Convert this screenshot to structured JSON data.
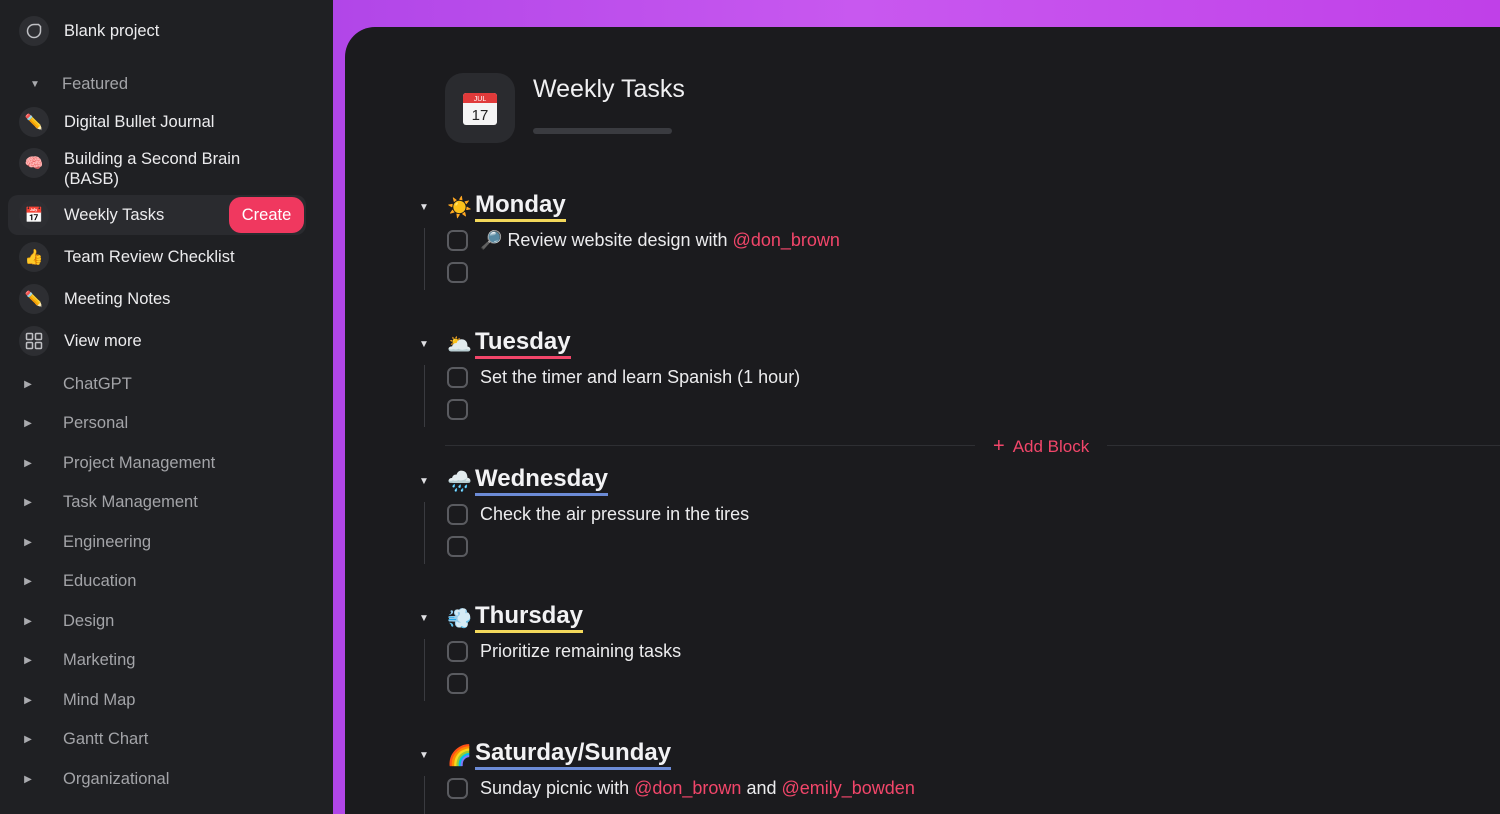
{
  "sidebar": {
    "blank_project": "Blank project",
    "featured": "Featured",
    "items": [
      {
        "label": "Digital Bullet Journal",
        "icon": "pencil-icon"
      },
      {
        "label": "Building a Second Brain",
        "label2": "(BASB)",
        "icon": "brain-icon"
      },
      {
        "label": "Weekly Tasks",
        "icon": "calendar-icon"
      },
      {
        "label": "Team Review Checklist",
        "icon": "thumbs-up-icon"
      },
      {
        "label": "Meeting Notes",
        "icon": "pencil-icon"
      },
      {
        "label": "View more",
        "icon": "grid-icon"
      }
    ],
    "create_label": "Create",
    "sections": [
      "ChatGPT",
      "Personal",
      "Project Management",
      "Task Management",
      "Engineering",
      "Education",
      "Design",
      "Marketing",
      "Mind Map",
      "Gantt Chart",
      "Organizational"
    ]
  },
  "page": {
    "title": "Weekly Tasks",
    "icon_label": "JUL",
    "icon_day": "17",
    "add_block": "Add Block"
  },
  "days": [
    {
      "name": "Monday",
      "emoji": "☀️",
      "underline": "#f3d85b",
      "tasks": [
        {
          "prefix": "🔎",
          "text": "Review website design with ",
          "mention": "@don_brown"
        }
      ]
    },
    {
      "name": "Tuesday",
      "emoji": "🌥️",
      "underline": "#f2466a",
      "tasks": [
        {
          "text": "Set the timer and learn Spanish (1 hour)"
        }
      ]
    },
    {
      "name": "Wednesday",
      "emoji": "🌧️",
      "underline": "#6c8bd6",
      "tasks": [
        {
          "text": "Check the air pressure in the tires"
        }
      ]
    },
    {
      "name": "Thursday",
      "emoji": "💨",
      "underline": "#f3d85b",
      "tasks": [
        {
          "text": "Prioritize remaining tasks"
        }
      ]
    },
    {
      "name": "Saturday/Sunday",
      "emoji": "🌈",
      "underline": "#6c8bd6",
      "tasks": [
        {
          "text": "Sunday picnic with ",
          "mention": "@don_brown",
          "mid": " and ",
          "mention2": "@emily_bowden"
        }
      ]
    }
  ],
  "colors": {
    "accent": "#f0385f",
    "mention": "#f2466a",
    "frame": "#c050ee"
  }
}
